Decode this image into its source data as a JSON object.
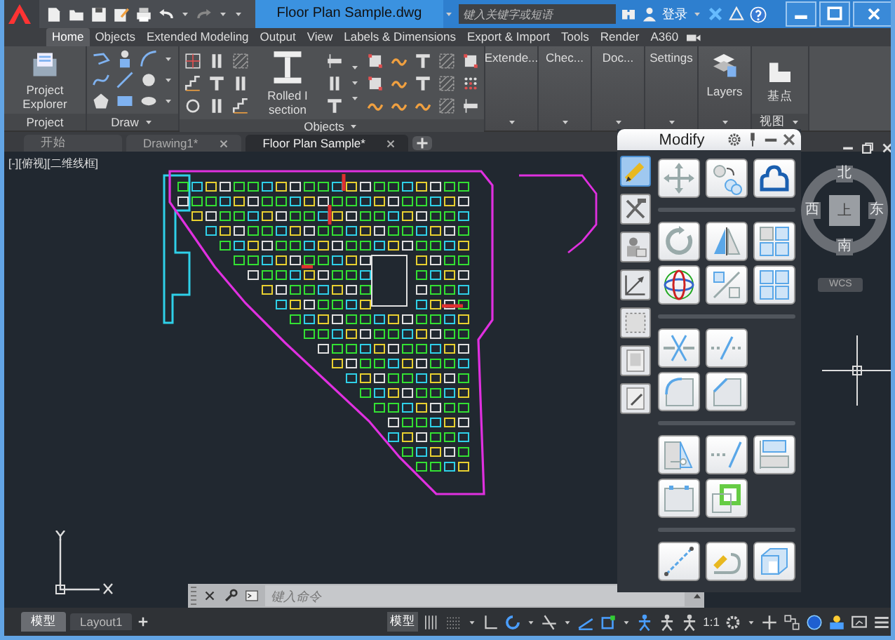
{
  "title_bar": {
    "title": "Floor Plan Sample.dwg",
    "search": {
      "placeholder": "键入关键字或短语"
    },
    "sign_in": "登录"
  },
  "ribbon_tabs": [
    {
      "label": "Home",
      "selected": true
    },
    {
      "label": "Objects",
      "selected": false
    },
    {
      "label": "Extended Modeling",
      "selected": false
    },
    {
      "label": "Output",
      "selected": false
    },
    {
      "label": "View",
      "selected": false
    },
    {
      "label": "Labels & Dimensions",
      "selected": false
    },
    {
      "label": "Export & Import",
      "selected": false
    },
    {
      "label": "Tools",
      "selected": false
    },
    {
      "label": "Render",
      "selected": false
    },
    {
      "label": "A360",
      "selected": false
    }
  ],
  "ribbon_panels": [
    {
      "kind": "project",
      "title": "Project",
      "button": "Project Explorer"
    },
    {
      "kind": "draw",
      "title": "Draw"
    },
    {
      "kind": "objects",
      "title": "Objects",
      "button": "Rolled I section"
    },
    {
      "kind": "collapsed",
      "label": "Extende..."
    },
    {
      "kind": "collapsed",
      "label": "Chec..."
    },
    {
      "kind": "collapsed",
      "label": "Doc..."
    },
    {
      "kind": "collapsed",
      "label": "Settings"
    },
    {
      "kind": "layers",
      "label": "Layers"
    },
    {
      "kind": "view",
      "label": "基点",
      "title": "视图"
    }
  ],
  "document_tabs": [
    {
      "label": "开始",
      "selected": false
    },
    {
      "label": "Drawing1*",
      "selected": false
    },
    {
      "label": "Floor Plan Sample*",
      "selected": true
    }
  ],
  "viewport_label": "[-][俯视][二维线框]",
  "modify_palette": {
    "title": "Modify"
  },
  "view_cube": {
    "top": "上",
    "north": "北",
    "east": "东",
    "south": "南",
    "west": "西",
    "ucs": "WCS"
  },
  "command_line": {
    "placeholder": "键入命令"
  },
  "layout_tabs": [
    {
      "label": "模型",
      "selected": true
    },
    {
      "label": "Layout1",
      "selected": false
    }
  ],
  "status_bar": {
    "space": "模型",
    "scale": "1:1"
  }
}
